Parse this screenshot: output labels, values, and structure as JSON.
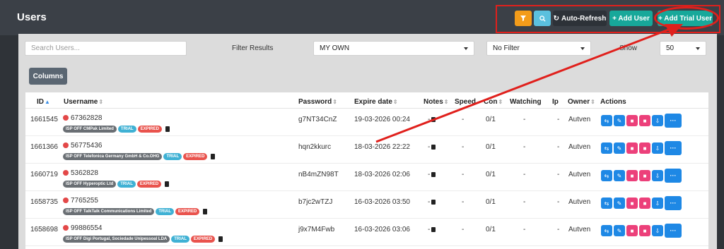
{
  "header": {
    "title": "Users",
    "buttons": {
      "filter_icon": "filter-icon",
      "search_icon": "search-icon",
      "auto_refresh": "Auto-Refresh",
      "add_user": "+ Add User",
      "add_trial_user": "+ Add Trial User"
    }
  },
  "filters": {
    "search_placeholder": "Search Users...",
    "filter_label": "Filter Results",
    "scope_value": "MY OWN",
    "filter_value": "No Filter",
    "show_label": "Show",
    "show_value": "50",
    "columns_button": "Columns"
  },
  "table": {
    "headers": {
      "id": "ID",
      "username": "Username",
      "password": "Password",
      "expire": "Expire date",
      "notes": "Notes",
      "speed": "Speed",
      "conn": "Con",
      "watching": "Watching",
      "ip": "Ip",
      "owner": "Owner",
      "actions": "Actions"
    },
    "rows": [
      {
        "id": "1661545",
        "username": "67362828",
        "isp": "ISP OFF CMPak Limited",
        "trial": "TRIAL",
        "expired": "EXPIRED",
        "password": "g7NT34CnZ",
        "expire": "19-03-2026 00:24",
        "notes": "-",
        "speed": "-",
        "conn": "0/1",
        "watching": "-",
        "ip": "-",
        "owner": "Autven"
      },
      {
        "id": "1661366",
        "username": "56775436",
        "isp": "ISP OFF Telefonica Germany GmbH & Co.OHG",
        "trial": "TRIAL",
        "expired": "EXPIRED",
        "password": "hqn2kkurc",
        "expire": "18-03-2026 22:22",
        "notes": "-",
        "speed": "-",
        "conn": "0/1",
        "watching": "-",
        "ip": "-",
        "owner": "Autven"
      },
      {
        "id": "1660719",
        "username": "5362828",
        "isp": "ISP OFF Hyperoptic Ltd",
        "trial": "TRIAL",
        "expired": "EXPIRED",
        "password": "nB4mZN98T",
        "expire": "18-03-2026 02:06",
        "notes": "-",
        "speed": "-",
        "conn": "0/1",
        "watching": "-",
        "ip": "-",
        "owner": "Autven"
      },
      {
        "id": "1658735",
        "username": "7765255",
        "isp": "ISP OFF TalkTalk Communications Limited",
        "trial": "TRIAL",
        "expired": "EXPIRED",
        "password": "b7jc2wTZJ",
        "expire": "16-03-2026 03:50",
        "notes": "-",
        "speed": "-",
        "conn": "0/1",
        "watching": "-",
        "ip": "-",
        "owner": "Autven"
      },
      {
        "id": "1658698",
        "username": "99886554",
        "isp": "ISP OFF Digi Portugal, Sociedade Unipessoal LDA",
        "trial": "TRIAL",
        "expired": "EXPIRED",
        "password": "j9x7M4Fwb",
        "expire": "16-03-2026 03:06",
        "notes": "-",
        "speed": "-",
        "conn": "0/1",
        "watching": "-",
        "ip": "-",
        "owner": "Autven"
      }
    ]
  },
  "colors": {
    "accent_teal": "#17a89a",
    "annotation_red": "#e0201c",
    "status_dot": "#e34848"
  }
}
